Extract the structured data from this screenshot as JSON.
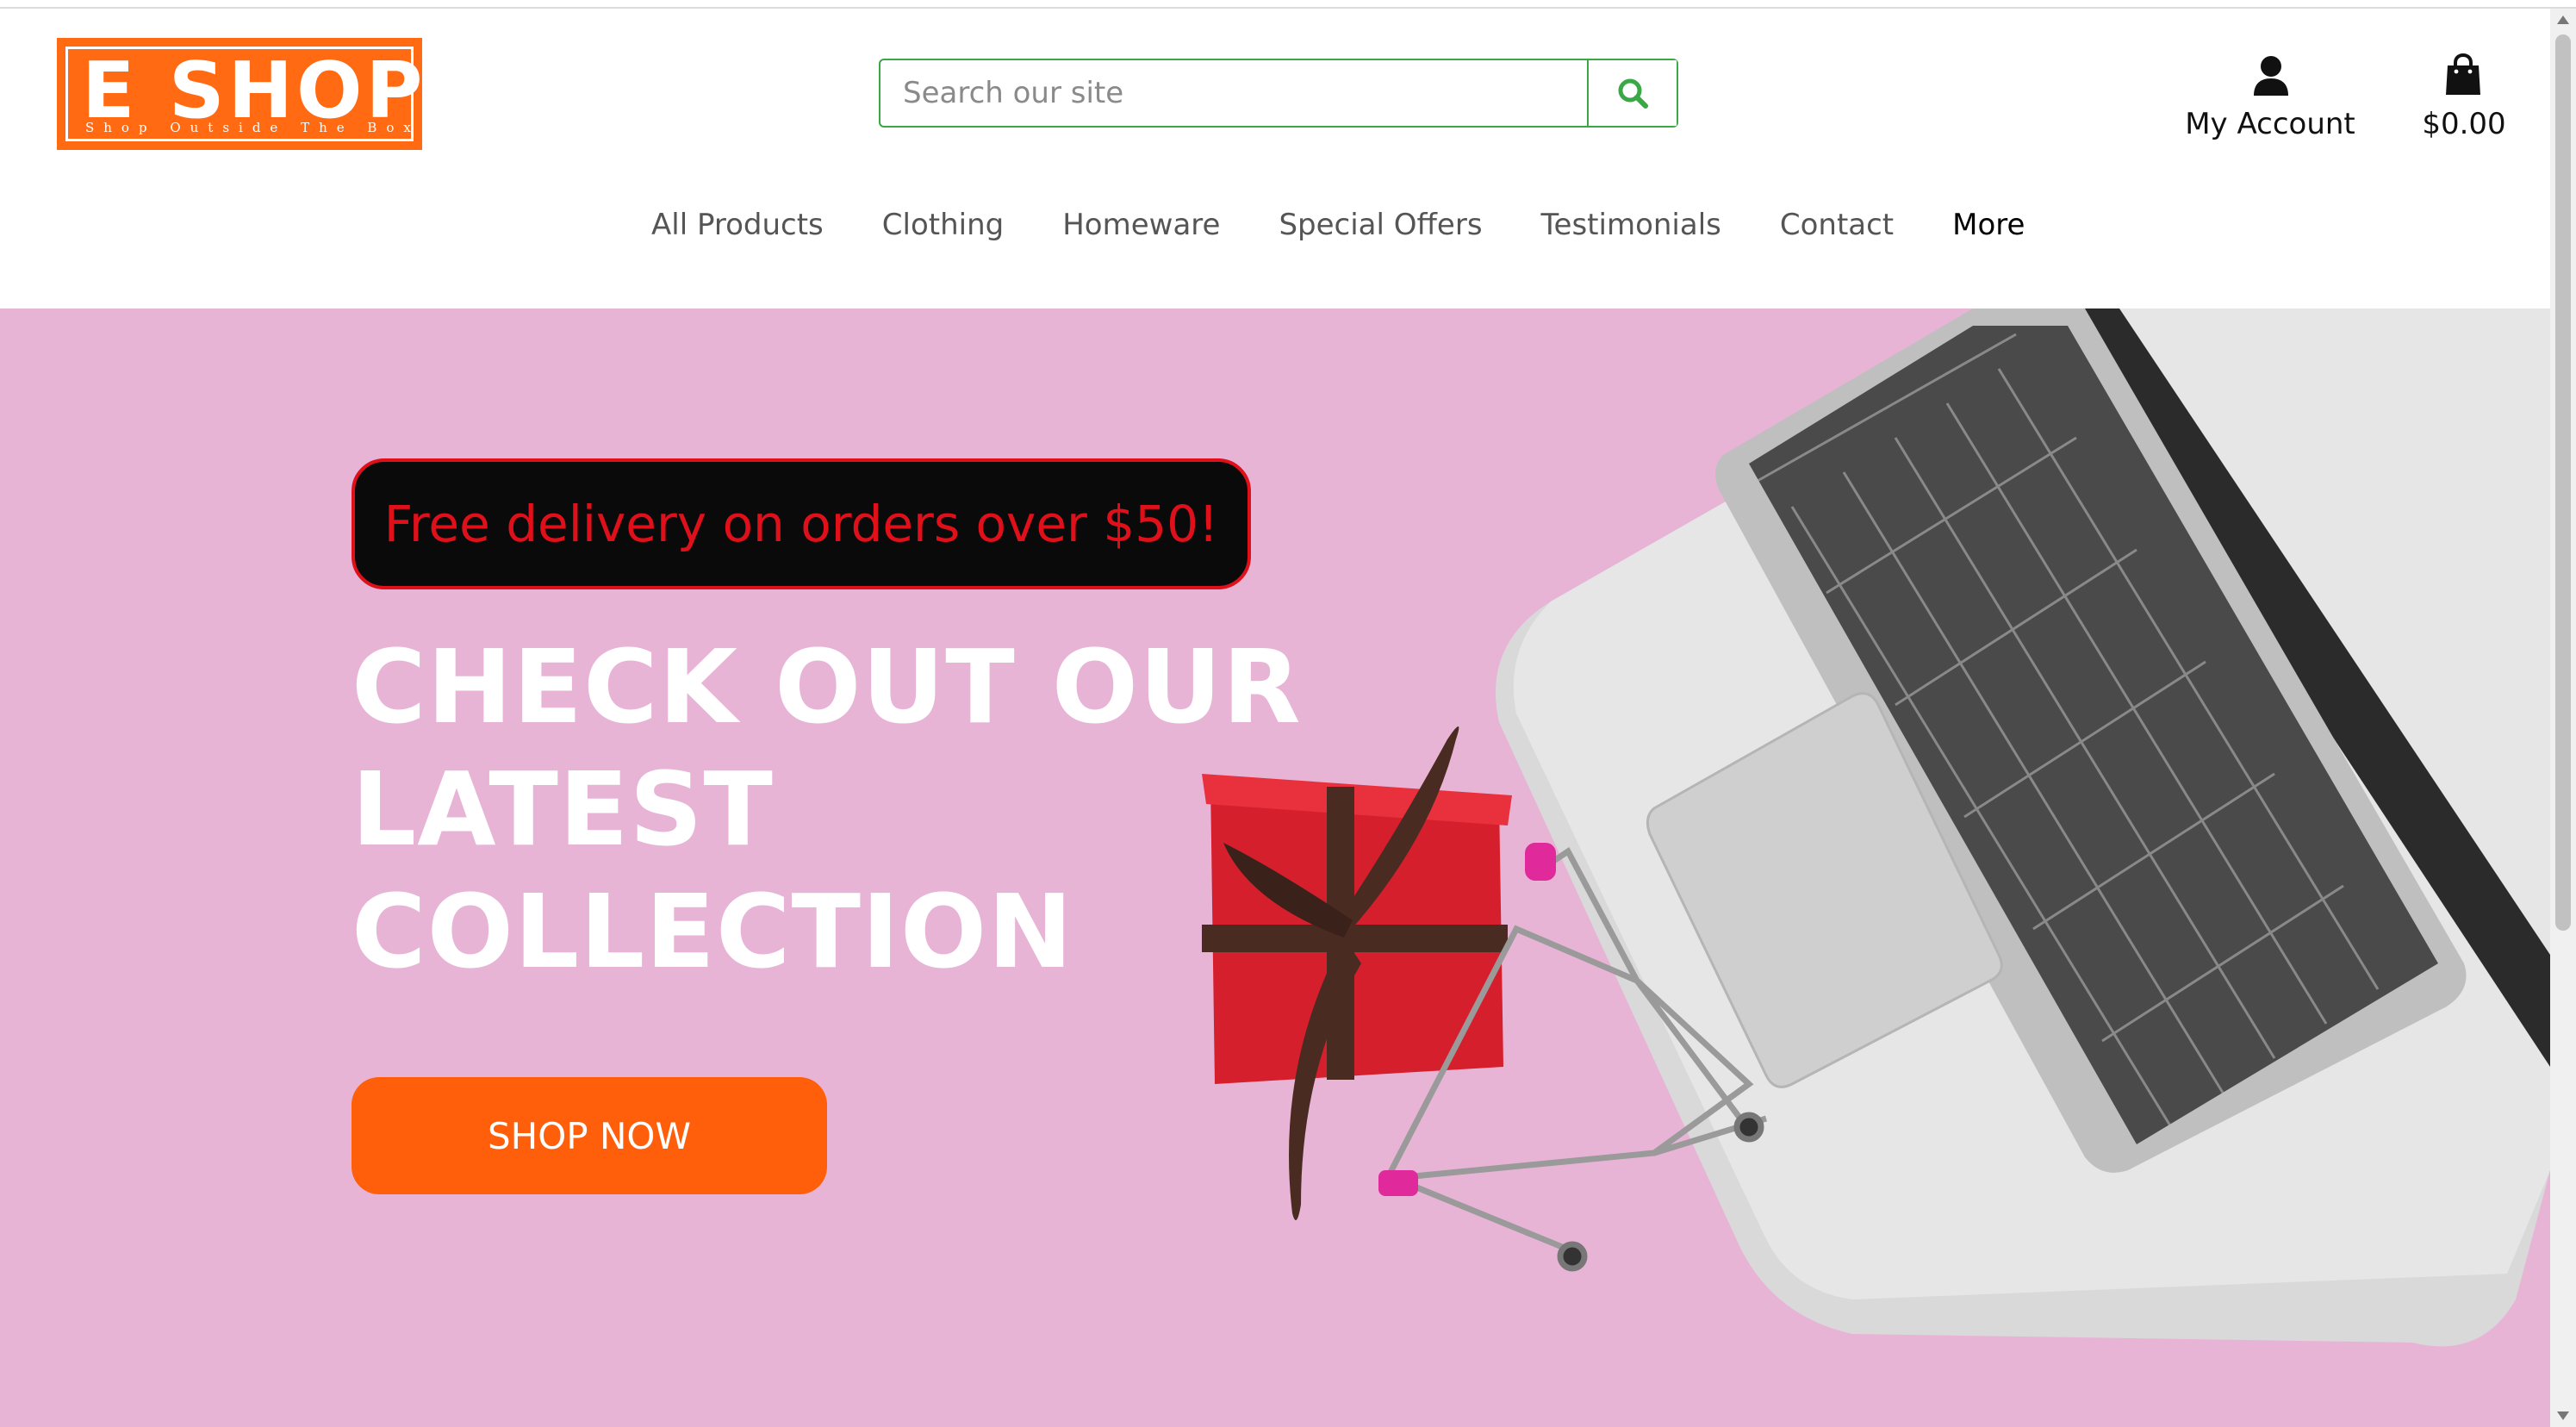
{
  "logo": {
    "title": "E SHOP",
    "tagline": "Shop Outside The Box",
    "color": "#ff6a13"
  },
  "search": {
    "placeholder": "Search our site",
    "value": "",
    "icon": "search-icon",
    "accent": "#39a845"
  },
  "account": {
    "label": "My Account",
    "icon": "user-icon"
  },
  "cart": {
    "total": "$0.00",
    "icon": "shopping-bag-icon"
  },
  "nav": {
    "items": [
      {
        "label": "All Products"
      },
      {
        "label": "Clothing"
      },
      {
        "label": "Homeware"
      },
      {
        "label": "Special Offers"
      },
      {
        "label": "Testimonials"
      },
      {
        "label": "Contact"
      },
      {
        "label": "More"
      }
    ]
  },
  "hero": {
    "promo": "Free delivery on orders over $50!",
    "headline": [
      "CHECK OUT OUR",
      "LATEST",
      "COLLECTION"
    ],
    "cta": "SHOP NOW",
    "background": "#e8b4d6",
    "cta_color": "#ff5f0a",
    "promo_color": "#e0101b"
  }
}
